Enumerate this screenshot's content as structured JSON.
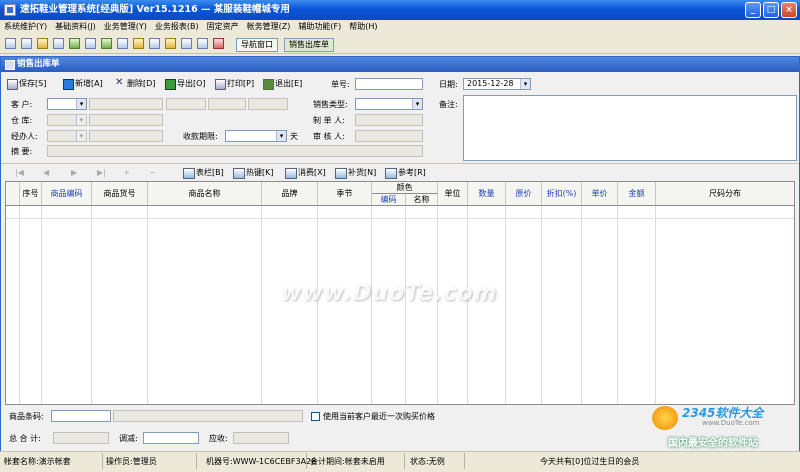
{
  "app_title": "速拓鞋业管理系统[经典版] Ver15.1216 — 某服装鞋帽城专用",
  "win_controls": [
    "_",
    "□",
    "×",
    "_",
    "□",
    "×"
  ],
  "menu": [
    "系统维护(Y)",
    "基础资料(J)",
    "业务管理(Y)",
    "业务报表(B)",
    "固定资产",
    "帐务管理(Z)",
    "辅助功能(F)",
    "帮助(H)"
  ],
  "toolbar_icons": [
    "file-icon",
    "grid-icon",
    "layers-icon",
    "card-icon",
    "chart-icon",
    "users-icon",
    "recycle-icon",
    "transfer-icon",
    "cash-icon",
    "printer-icon",
    "folder-icon",
    "mail-icon",
    "help-icon",
    "exit-icon"
  ],
  "nav_buttons": [
    "导航窗口",
    "销售出库单"
  ],
  "doc_title": "销售出库单",
  "doc_toolbar": {
    "save": "保存[S]",
    "add": "新增[A]",
    "delete": "删除[D]",
    "export": "导出[O]",
    "print": "打印[P]",
    "exit": "退出[E]"
  },
  "form": {
    "doc_no_label": "单号:",
    "doc_no": "",
    "date_label": "日期:",
    "date": "2015-12-28",
    "customer_label": "客  户:",
    "warehouse_label": "仓  库:",
    "handler_label": "经办人:",
    "memo_label": "摘  要:",
    "payment_days_label": "收款期限:",
    "payment_days_unit": "天",
    "sale_type_label": "销售类型:",
    "maker_label": "制 单 人:",
    "auditor_label": "审 核 人:",
    "remark_label": "备注:"
  },
  "grid_toolbar": {
    "nav": [
      "|◀",
      "◀",
      "▶",
      "▶|",
      "+",
      "−"
    ],
    "columns": "表栏[B]",
    "hotkeys": "热键[K]",
    "consume": "消费[X]",
    "replenish": "补货[N]",
    "reference": "参考[R]"
  },
  "grid": {
    "columns": [
      "序号",
      "商品编码",
      "商品货号",
      "商品名称",
      "品牌",
      "季节",
      "颜色",
      "单位",
      "数量",
      "原价",
      "折扣(%)",
      "单价",
      "金额",
      "尺码分布"
    ],
    "color_sub": [
      "编码",
      "名称"
    ]
  },
  "bottom": {
    "barcode_label": "商品条码:",
    "use_last_price": "使用当前客户最近一次购买价格",
    "total_label": "总 合 计:",
    "adjust_label": "调减:",
    "receivable_label": "应收:"
  },
  "status": {
    "account": "帐套名称:演示帐套",
    "operator": "操作员:管理员",
    "machine": "机器号:WWW-1C6CEBF3A28",
    "period": "会计期间:帐套未启用",
    "state": "状态:无例",
    "birthday": "今天共有[0]位过生日的会员"
  },
  "watermark": "www.DuoTe.com",
  "logo": {
    "brand": "2345软件大全",
    "url": "www.DuoTe.com",
    "slogan": "国内最安全的软件站"
  }
}
